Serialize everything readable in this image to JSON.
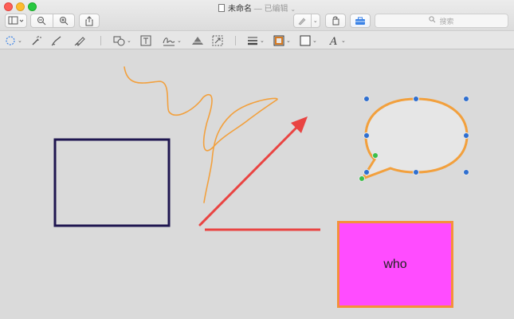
{
  "window": {
    "title": "未命名",
    "separator": "—",
    "status": "已编辑"
  },
  "search": {
    "placeholder": "搜索"
  },
  "canvas": {
    "text_box": "who",
    "colors": {
      "rectangle_stroke": "#1f1650",
      "arrow": "#e94442",
      "line": "#e94442",
      "squiggle": "#f2a03d",
      "bubble_stroke": "#f2a03d",
      "bubble_fill": "#e6e6e6",
      "handle": "#2f6fd0",
      "handle_green": "#3cc04a",
      "text_box_fill": "#ff4cff",
      "text_box_border": "#f4913a"
    }
  }
}
